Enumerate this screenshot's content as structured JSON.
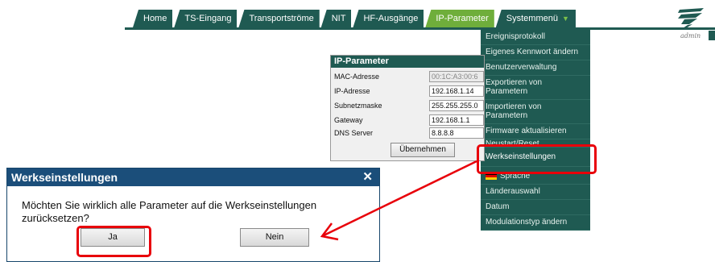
{
  "nav": {
    "tabs": [
      "Home",
      "TS-Eingang",
      "Transportströme",
      "NIT",
      "HF-Ausgänge",
      "IP-Parameter",
      "Systemmenü"
    ],
    "active_tab": "IP-Parameter",
    "user": "admin"
  },
  "menu": {
    "items": [
      "Ereignisprotokoll",
      "Eigenes Kennwort ändern",
      "Benutzerverwaltung",
      "Exportieren von Parametern",
      "Importieren von Parametern",
      "Firmware aktualisieren",
      "Neustart/Reset",
      "Werkseinstellungen",
      "Sprache",
      "Länderauswahl",
      "Datum",
      "Modulationstyp ändern"
    ]
  },
  "ip_panel": {
    "title": "IP-Parameter",
    "rows": [
      {
        "label": "MAC-Adresse",
        "value": "00:1C:A3:00:6"
      },
      {
        "label": "IP-Adresse",
        "value": "192.168.1.14"
      },
      {
        "label": "Subnetzmaske",
        "value": "255.255.255.0"
      },
      {
        "label": "Gateway",
        "value": "192.168.1.1"
      },
      {
        "label": "DNS Server",
        "value": "8.8.8.8"
      }
    ],
    "apply_label": "Übernehmen"
  },
  "dialog": {
    "title": "Werkseinstellungen",
    "close": "✕",
    "message": "Möchten Sie wirklich alle Parameter auf die Werkseinstellungen zurücksetzen?",
    "yes_label": "Ja",
    "no_label": "Nein"
  },
  "colors": {
    "nav_green": "#1f5a52",
    "active_tab": "#6fae3b",
    "dialog_blue": "#1b4e7a",
    "annotation_red": "#e8000a"
  }
}
